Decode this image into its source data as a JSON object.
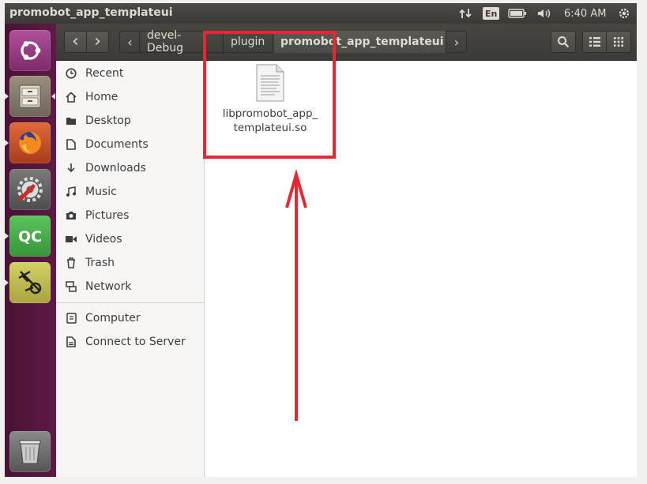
{
  "window": {
    "title": "promobot_app_templateui"
  },
  "top_panel": {
    "keyboard_layout": "En",
    "clock": "6:40 AM"
  },
  "launcher": {
    "items": [
      "ubuntu-dash",
      "files",
      "firefox",
      "system-settings",
      "qt-creator",
      "qt-designer",
      "trash"
    ]
  },
  "toolbar": {
    "back_glyph": "‹",
    "forward_glyph": "›",
    "crumb_left_arrow": "‹",
    "crumb_right_arrow": "›",
    "breadcrumbs": [
      "devel-Debug",
      "plugin",
      "promobot_app_templateui"
    ]
  },
  "sidebar": {
    "places": [
      {
        "label": "Recent",
        "icon": "clock-icon"
      },
      {
        "label": "Home",
        "icon": "home-icon"
      },
      {
        "label": "Desktop",
        "icon": "desktop-folder-icon"
      },
      {
        "label": "Documents",
        "icon": "document-icon"
      },
      {
        "label": "Downloads",
        "icon": "download-icon"
      },
      {
        "label": "Music",
        "icon": "music-icon"
      },
      {
        "label": "Pictures",
        "icon": "camera-icon"
      },
      {
        "label": "Videos",
        "icon": "video-icon"
      },
      {
        "label": "Trash",
        "icon": "trash-icon"
      },
      {
        "label": "Network",
        "icon": "network-icon"
      }
    ],
    "devices": [
      {
        "label": "Computer",
        "icon": "computer-icon"
      },
      {
        "label": "Connect to Server",
        "icon": "server-icon"
      }
    ]
  },
  "files": [
    {
      "name_line1": "libpromobot_app_",
      "name_line2": "templateui.so",
      "icon": "shared-library-file-icon"
    }
  ],
  "annotation": {
    "color": "#e52833",
    "description_marks": [
      "highlight-box",
      "up-arrow"
    ]
  },
  "colors": {
    "launcher_bg": "#5e1a44",
    "panel_bg": "#3c3b37",
    "accent": "#e52833"
  }
}
